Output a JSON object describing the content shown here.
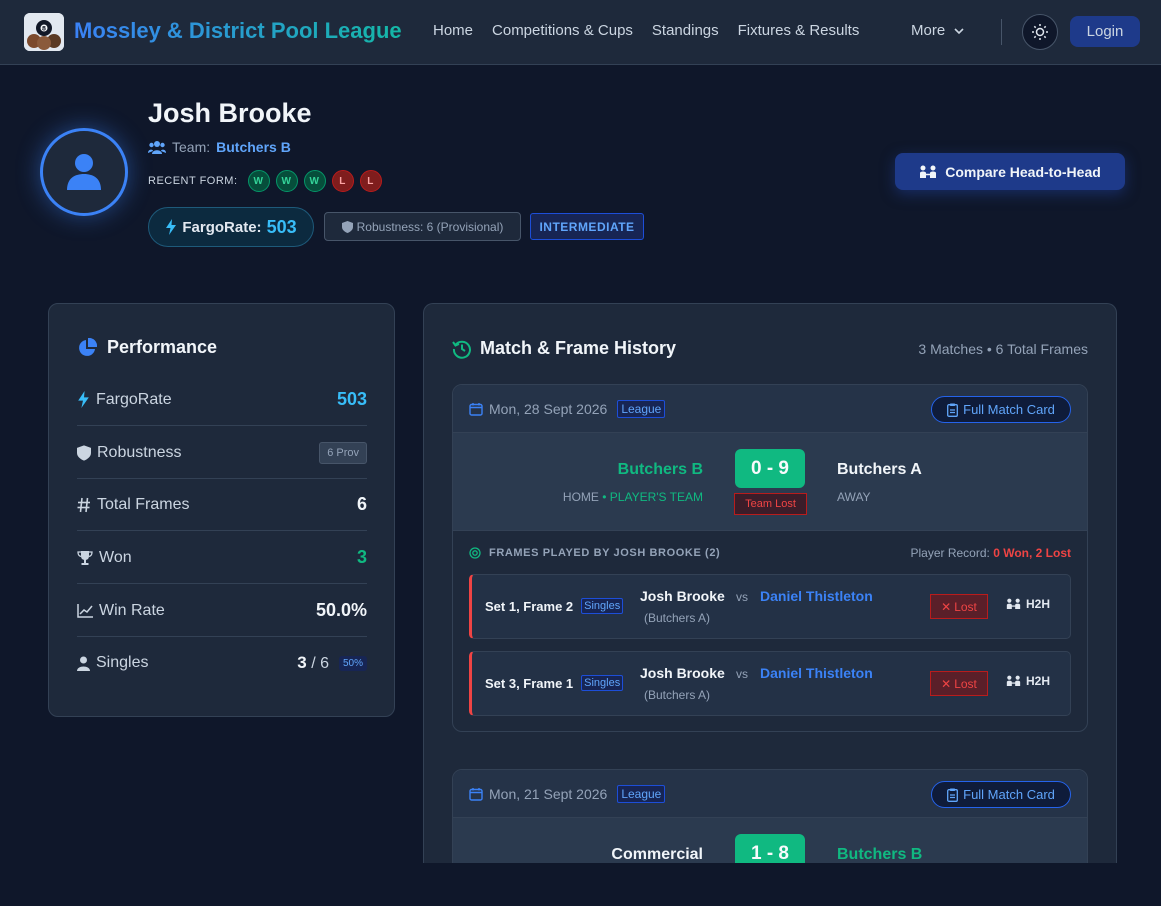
{
  "nav": {
    "brand": "Mossley & District Pool League",
    "links": [
      "Home",
      "Competitions & Cups",
      "Standings",
      "Fixtures & Results"
    ],
    "more": "More",
    "login": "Login"
  },
  "player": {
    "name": "Josh Brooke",
    "team_prefix": "Team:",
    "team": "Butchers B",
    "form_label": "RECENT FORM:",
    "form": [
      "W",
      "W",
      "W",
      "L",
      "L"
    ],
    "fargo_label": "FargoRate:",
    "fargo_value": "503",
    "robustness": "Robustness: 6 (Provisional)",
    "level": "INTERMEDIATE",
    "compare_label": "Compare Head-to-Head"
  },
  "performance": {
    "title": "Performance",
    "rows": [
      {
        "label": "FargoRate",
        "value": "503",
        "icon": "bolt-icon"
      },
      {
        "label": "Robustness",
        "value": "6 Prov",
        "icon": "shield-icon"
      },
      {
        "label": "Total Frames",
        "value": "6",
        "icon": "hash-icon"
      },
      {
        "label": "Won",
        "value": "3",
        "icon": "trophy-icon"
      },
      {
        "label": "Win Rate",
        "value": "50.0%",
        "icon": "chart-line-icon"
      },
      {
        "label": "Singles",
        "value_won": "3",
        "value_sep": "/ 6",
        "value_pct": "50%",
        "icon": "user-icon"
      }
    ]
  },
  "history": {
    "title": "Match & Frame History",
    "summary": "3 Matches • 6 Total Frames",
    "card_label": "Full Match Card",
    "league_tag": "League",
    "matches": [
      {
        "date": "Mon, 28 Sept 2026",
        "home": "Butchers B",
        "home_sub": "HOME",
        "home_sub_sep": " • ",
        "home_sub_team": "PLAYER'S TEAM",
        "score": "0 - 9",
        "result": "Team Lost",
        "away": "Butchers A",
        "away_sub": "AWAY",
        "frames_head": "FRAMES PLAYED BY JOSH BROOKE (2)",
        "record_label": "Player Record:",
        "record_value": "0 Won, 2 Lost",
        "frames": [
          {
            "label": "Set 1, Frame 2",
            "type": "Singles",
            "player": "Josh Brooke",
            "vs": "vs",
            "opponent": "Daniel Thistleton",
            "opp_team": "(Butchers A)",
            "result": "Lost",
            "h2h": "H2H"
          },
          {
            "label": "Set 3, Frame 1",
            "type": "Singles",
            "player": "Josh Brooke",
            "vs": "vs",
            "opponent": "Daniel Thistleton",
            "opp_team": "(Butchers A)",
            "result": "Lost",
            "h2h": "H2H"
          }
        ]
      },
      {
        "date": "Mon, 21 Sept 2026",
        "home": "Commercial",
        "score": "1 - 8",
        "away": "Butchers B"
      }
    ]
  },
  "colors": {
    "accent": "#3b82f6",
    "win": "#10b981",
    "loss": "#ef4444",
    "bg": "#0f172a",
    "card": "#1e293b"
  }
}
